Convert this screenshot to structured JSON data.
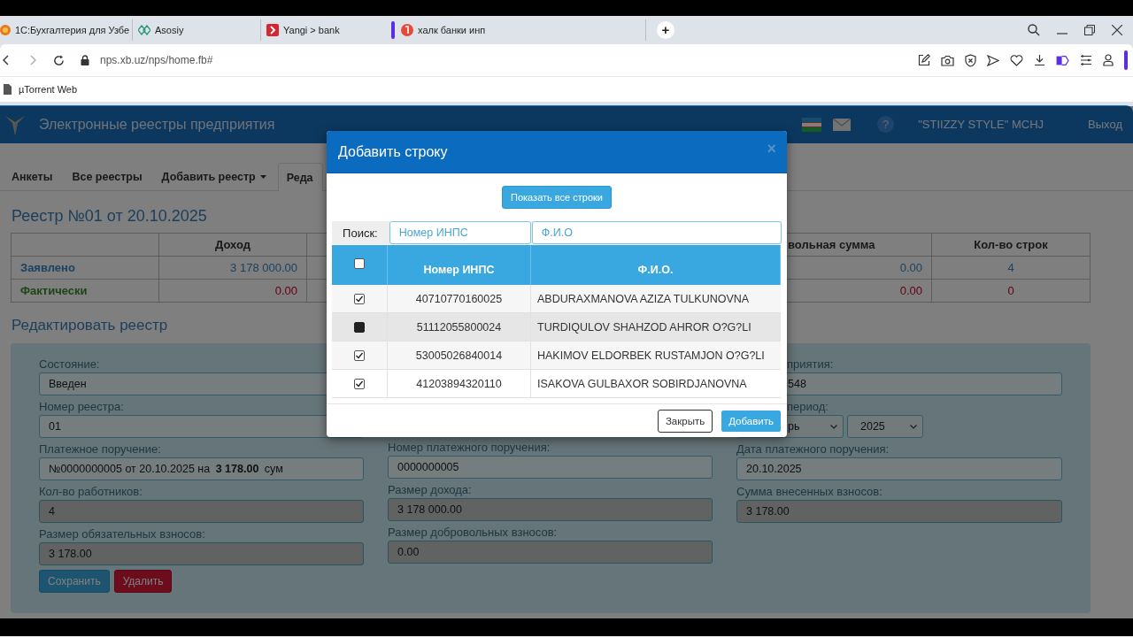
{
  "browser": {
    "tabs": [
      {
        "title": "1С:Бухгалтерия для Узбе"
      },
      {
        "title": "Asosiy"
      },
      {
        "title": "Yangi > bank"
      },
      {
        "title": "халк банки инп"
      }
    ],
    "new_tab": "+",
    "address": "nps.xb.uz/nps/home.fb#",
    "bookmarks": [
      "µTorrent Web"
    ]
  },
  "app": {
    "title": "Электронные реестры предприятия",
    "help": "?",
    "company": "\"STIIZZY STYLE\" MCHJ",
    "logout": "Выход"
  },
  "nav_tabs": [
    {
      "label": "Анкеты",
      "selected": false,
      "dropdown": false
    },
    {
      "label": "Все реестры",
      "selected": false,
      "dropdown": false
    },
    {
      "label": "Добавить реестр",
      "selected": false,
      "dropdown": true
    },
    {
      "label": "Реда",
      "selected": true,
      "dropdown": false
    }
  ],
  "registry": {
    "heading": "Реестр №01 от 20.10.2025",
    "columns": [
      "Доход",
      "вольная сумма",
      "Кол-во строк"
    ],
    "rows": [
      {
        "label": "Заявлено",
        "kind": "declared",
        "cells": [
          "3 178 000.00",
          "0.00",
          "4"
        ]
      },
      {
        "label": "Фактически",
        "kind": "actual",
        "cells": [
          "0.00",
          "0.00",
          "0"
        ]
      }
    ]
  },
  "edit_form": {
    "heading": "Редактировать реестр",
    "column_1": [
      {
        "label": "Состояние:",
        "value": "Введен",
        "readonly": false
      },
      {
        "label": "Номер реестра:",
        "value": "01",
        "readonly": false
      },
      {
        "label": "Платежное поручение:",
        "value": "№0000000005 от 20.10.2025 на **3 178.00** сум",
        "readonly": false
      },
      {
        "label": "Кол-во работников:",
        "value": "4",
        "readonly": true
      },
      {
        "label": "Размер обязательных взносов:",
        "value": "3 178.00",
        "readonly": true
      }
    ],
    "column_2": [
      {
        "label": "Номер платежного поручения:",
        "value": "0000000005",
        "readonly": false
      },
      {
        "label": "Размер дохода:",
        "value": "3 178 000.00",
        "readonly": true
      },
      {
        "label": "Размер добровольных взносов:",
        "value": "0.00",
        "readonly": true
      }
    ],
    "column_3": [
      {
        "kind": "text",
        "label": "приятия:",
        "value": "548",
        "readonly": false,
        "cut": true
      },
      {
        "kind": "period",
        "label": "период:",
        "selects": [
          "рь",
          "2025"
        ],
        "cut": true
      },
      {
        "kind": "text",
        "label": "Дата платежного поручения:",
        "value": "20.10.2025",
        "readonly": false,
        "cut": false
      },
      {
        "kind": "text",
        "label": "Сумма внесенных взносов:",
        "value": "3 178.00",
        "readonly": true,
        "cut": false
      }
    ],
    "buttons": [
      {
        "label": "Сохранить",
        "kind": "primary"
      },
      {
        "label": "Удалить",
        "kind": "danger"
      }
    ]
  },
  "dialog": {
    "title": "Добавить строку",
    "close": "×",
    "show_all": "Показать все строки",
    "search_label": "Поиск:",
    "search_fields": [
      {
        "placeholder": "Номер ИНПС"
      },
      {
        "placeholder": "Ф.И.О"
      }
    ],
    "select_all": {
      "checked": false
    },
    "columns": [
      "Номер ИНПС",
      "Ф.И.О."
    ],
    "rows": [
      {
        "inps": "40710770160025",
        "name": "ABDURAXMANOVA AZIZA TULKUNOVNA",
        "checked": true,
        "highlighted": false
      },
      {
        "inps": "51112055800024",
        "name": "TURDIQULOV SHAHZOD AHROR O?G?LI",
        "checked": false,
        "highlighted": true
      },
      {
        "inps": "53005026840014",
        "name": "HAKIMOV ELDORBEK RUSTAMJON O?G?LI",
        "checked": true,
        "highlighted": false
      },
      {
        "inps": "41203894320110",
        "name": "ISAKOVA GULBAXOR SOBIRDJANOVNA",
        "checked": true,
        "highlighted": false
      }
    ],
    "buttons": [
      {
        "label": "Закрыть",
        "kind": "default"
      },
      {
        "label": "Добавить",
        "kind": "primary"
      }
    ]
  }
}
